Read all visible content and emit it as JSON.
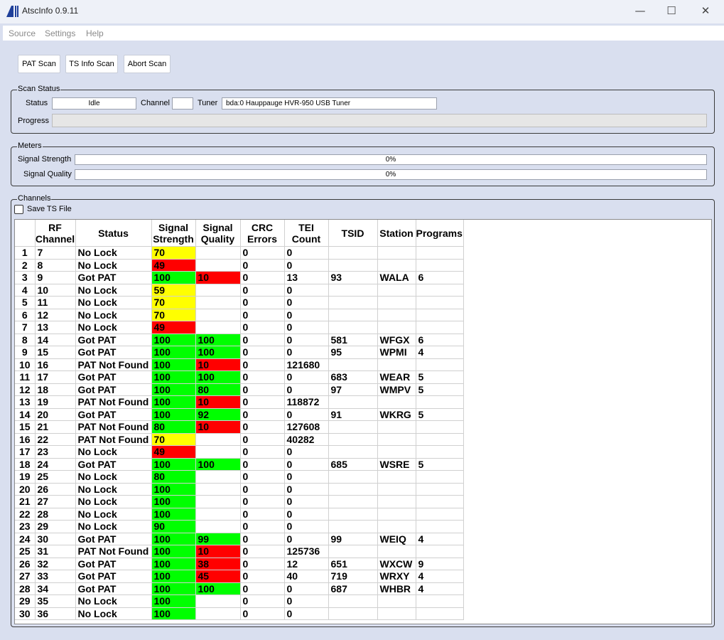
{
  "window": {
    "title": "AtscInfo 0.9.11"
  },
  "menu": [
    "Source",
    "Settings",
    "Help"
  ],
  "toolbar": {
    "pat_scan": "PAT Scan",
    "ts_info_scan": "TS Info Scan",
    "abort_scan": "Abort Scan"
  },
  "scan_status": {
    "legend": "Scan Status",
    "status_label": "Status",
    "status_value": "Idle",
    "channel_label": "Channel",
    "channel_value": "",
    "tuner_label": "Tuner",
    "tuner_value": "bda:0 Hauppauge HVR-950 USB Tuner",
    "progress_label": "Progress",
    "progress": 0
  },
  "meters": {
    "legend": "Meters",
    "strength_label": "Signal Strength",
    "strength_text": "0%",
    "strength": 0,
    "quality_label": "Signal Quality",
    "quality_text": "0%",
    "quality": 0
  },
  "channels": {
    "legend": "Channels",
    "save_ts_label": "Save TS File",
    "save_ts_checked": false,
    "colors": {
      "green": "#00ff00",
      "yellow": "#ffff00",
      "red": "#ff0000"
    },
    "headers": [
      "",
      "RF Channel",
      "Status",
      "Signal Strength",
      "Signal Quality",
      "CRC Errors",
      "TEI Count",
      "TSID",
      "Station",
      "Programs"
    ],
    "rows": [
      [
        "1",
        "7",
        "No Lock",
        "70",
        "",
        "0",
        "0",
        "",
        "",
        ""
      ],
      [
        "2",
        "8",
        "No Lock",
        "49",
        "",
        "0",
        "0",
        "",
        "",
        ""
      ],
      [
        "3",
        "9",
        "Got PAT",
        "100",
        "10",
        "0",
        "13",
        "93",
        "WALA",
        "6"
      ],
      [
        "4",
        "10",
        "No Lock",
        "59",
        "",
        "0",
        "0",
        "",
        "",
        ""
      ],
      [
        "5",
        "11",
        "No Lock",
        "70",
        "",
        "0",
        "0",
        "",
        "",
        ""
      ],
      [
        "6",
        "12",
        "No Lock",
        "70",
        "",
        "0",
        "0",
        "",
        "",
        ""
      ],
      [
        "7",
        "13",
        "No Lock",
        "49",
        "",
        "0",
        "0",
        "",
        "",
        ""
      ],
      [
        "8",
        "14",
        "Got PAT",
        "100",
        "100",
        "0",
        "0",
        "581",
        "WFGX",
        "6"
      ],
      [
        "9",
        "15",
        "Got PAT",
        "100",
        "100",
        "0",
        "0",
        "95",
        "WPMI",
        "4"
      ],
      [
        "10",
        "16",
        "PAT Not Found",
        "100",
        "10",
        "0",
        "121680",
        "",
        "",
        ""
      ],
      [
        "11",
        "17",
        "Got PAT",
        "100",
        "100",
        "0",
        "0",
        "683",
        "WEAR",
        "5"
      ],
      [
        "12",
        "18",
        "Got PAT",
        "100",
        "80",
        "0",
        "0",
        "97",
        "WMPV",
        "5"
      ],
      [
        "13",
        "19",
        "PAT Not Found",
        "100",
        "10",
        "0",
        "118872",
        "",
        "",
        ""
      ],
      [
        "14",
        "20",
        "Got PAT",
        "100",
        "92",
        "0",
        "0",
        "91",
        "WKRG",
        "5"
      ],
      [
        "15",
        "21",
        "PAT Not Found",
        "80",
        "10",
        "0",
        "127608",
        "",
        "",
        ""
      ],
      [
        "16",
        "22",
        "PAT Not Found",
        "70",
        "",
        "0",
        "40282",
        "",
        "",
        ""
      ],
      [
        "17",
        "23",
        "No Lock",
        "49",
        "",
        "0",
        "0",
        "",
        "",
        ""
      ],
      [
        "18",
        "24",
        "Got PAT",
        "100",
        "100",
        "0",
        "0",
        "685",
        "WSRE",
        "5"
      ],
      [
        "19",
        "25",
        "No Lock",
        "80",
        "",
        "0",
        "0",
        "",
        "",
        ""
      ],
      [
        "20",
        "26",
        "No Lock",
        "100",
        "",
        "0",
        "0",
        "",
        "",
        ""
      ],
      [
        "21",
        "27",
        "No Lock",
        "100",
        "",
        "0",
        "0",
        "",
        "",
        ""
      ],
      [
        "22",
        "28",
        "No Lock",
        "100",
        "",
        "0",
        "0",
        "",
        "",
        ""
      ],
      [
        "23",
        "29",
        "No Lock",
        "90",
        "",
        "0",
        "0",
        "",
        "",
        ""
      ],
      [
        "24",
        "30",
        "Got PAT",
        "100",
        "99",
        "0",
        "0",
        "99",
        "WEIQ",
        "4"
      ],
      [
        "25",
        "31",
        "PAT Not Found",
        "100",
        "10",
        "0",
        "125736",
        "",
        "",
        ""
      ],
      [
        "26",
        "32",
        "Got PAT",
        "100",
        "38",
        "0",
        "12",
        "651",
        "WXCW",
        "9"
      ],
      [
        "27",
        "33",
        "Got PAT",
        "100",
        "45",
        "0",
        "40",
        "719",
        "WRXY",
        "4"
      ],
      [
        "28",
        "34",
        "Got PAT",
        "100",
        "100",
        "0",
        "0",
        "687",
        "WHBR",
        "4"
      ],
      [
        "29",
        "35",
        "No Lock",
        "100",
        "",
        "0",
        "0",
        "",
        "",
        ""
      ],
      [
        "30",
        "36",
        "No Lock",
        "100",
        "",
        "0",
        "0",
        "",
        "",
        ""
      ]
    ],
    "strength_colors": [
      "yellow",
      "red",
      "green",
      "yellow",
      "yellow",
      "yellow",
      "red",
      "green",
      "green",
      "green",
      "green",
      "green",
      "green",
      "green",
      "green",
      "yellow",
      "red",
      "green",
      "green",
      "green",
      "green",
      "green",
      "green",
      "green",
      "green",
      "green",
      "green",
      "green",
      "green",
      "green"
    ],
    "quality_colors": [
      "",
      "",
      "red",
      "",
      "",
      "",
      "",
      "green",
      "green",
      "red",
      "green",
      "green",
      "red",
      "green",
      "red",
      "",
      "",
      "green",
      "",
      "",
      "",
      "",
      "",
      "green",
      "red",
      "red",
      "red",
      "green",
      "",
      ""
    ]
  }
}
